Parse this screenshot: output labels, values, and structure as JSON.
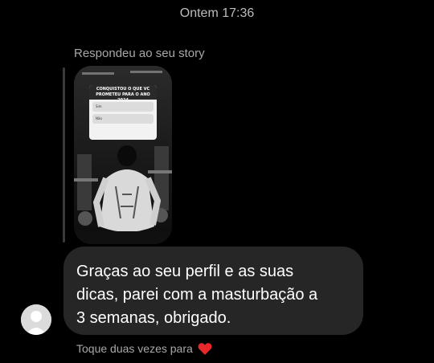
{
  "conversation": {
    "timestamp": "Ontem 17:36",
    "reply_note": "Respondeu ao seu story",
    "story": {
      "question": "CONQUISTOU O QUE VC PROMETEU PARA O ANO 2024",
      "options": [
        "Sim",
        "Não"
      ]
    },
    "message": "Graças ao seu perfil e as suas\ndicas, parei com a masturbação a\n3 semanas, obrigado.",
    "hint": "Toque duas vezes para",
    "hint_icon": "heart-icon"
  },
  "colors": {
    "background": "#000000",
    "bubble": "#262626",
    "heart": "#e8282b"
  }
}
